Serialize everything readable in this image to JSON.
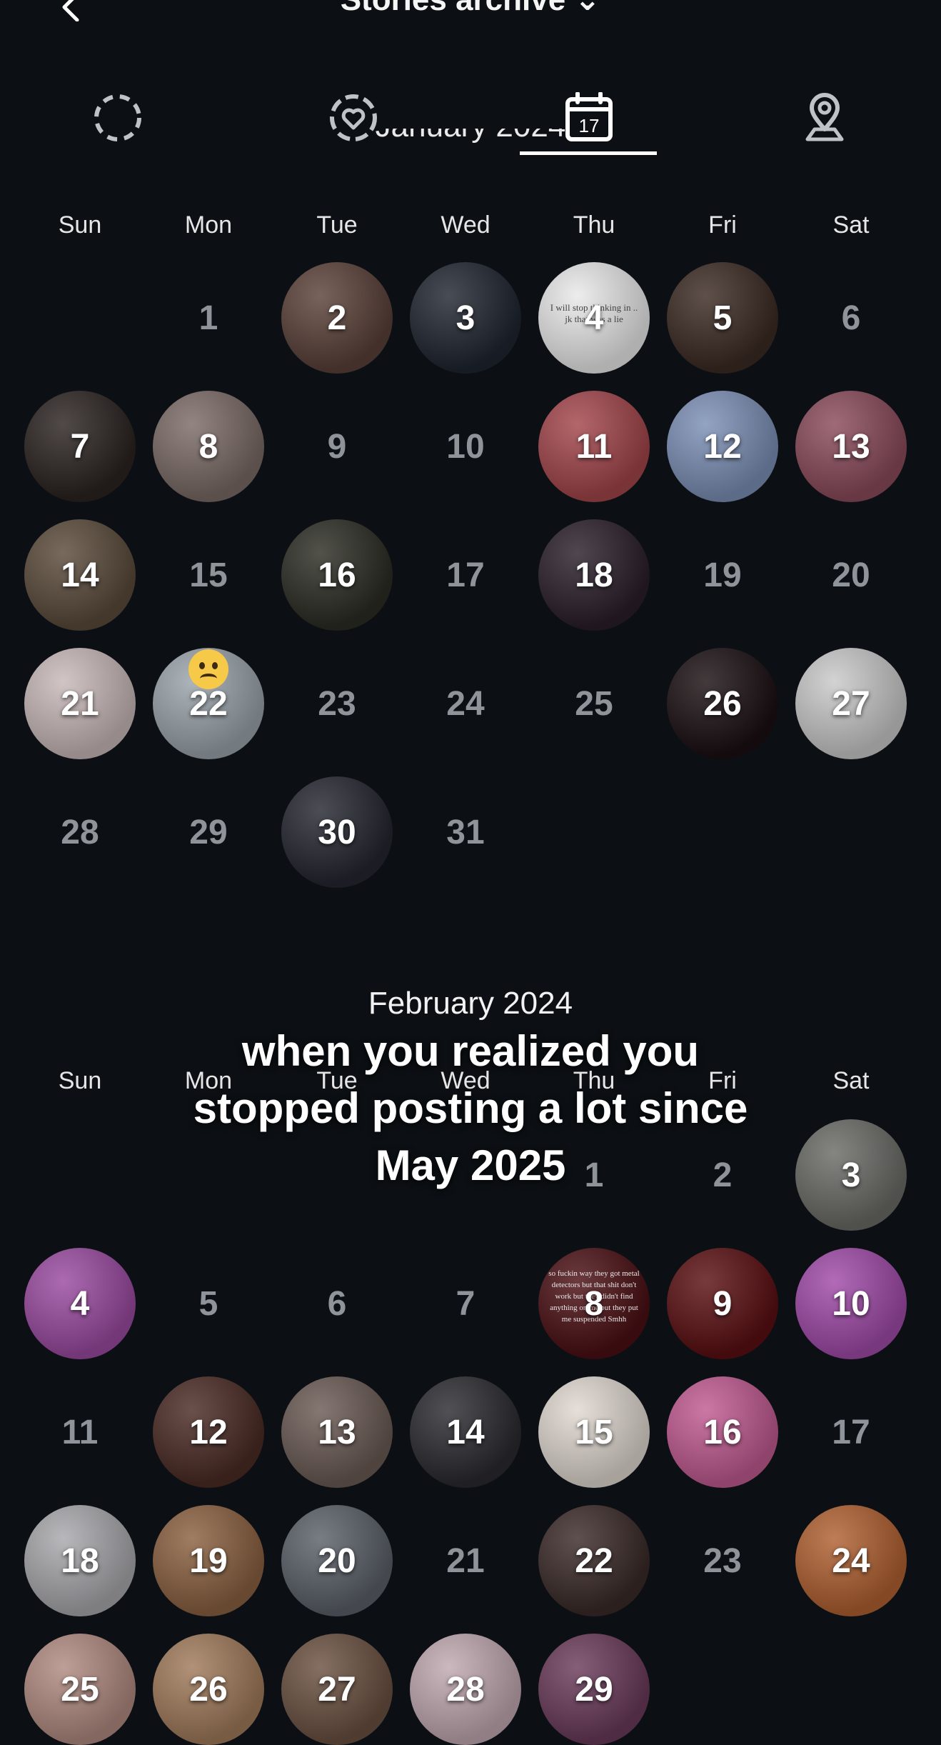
{
  "header": {
    "title": "Stories archive"
  },
  "tabs": [
    {
      "name": "tab-all",
      "icon": "dashed-circle-icon",
      "active": false
    },
    {
      "name": "tab-highlights",
      "icon": "heart-circle-icon",
      "active": false
    },
    {
      "name": "tab-calendar",
      "icon": "calendar-icon",
      "calendar_day": "17",
      "active": true
    },
    {
      "name": "tab-map",
      "icon": "map-pin-icon",
      "active": false
    }
  ],
  "weekdays": [
    "Sun",
    "Mon",
    "Tue",
    "Wed",
    "Thu",
    "Fri",
    "Sat"
  ],
  "months": [
    {
      "title": "January 2024",
      "first_weekday": 1,
      "days": 31,
      "story_days": {
        "2": "#5a4038",
        "3": "#1f2530",
        "4": "#e9e9ea",
        "5": "#3b2a22",
        "7": "#2a2220",
        "8": "#7a6a66",
        "11": "#a2454a",
        "12": "#7b8fb5",
        "13": "#8a4a5a",
        "14": "#5a4a3a",
        "16": "#2c2c24",
        "18": "#2a1e2a",
        "21": "#c8b8b8",
        "22": "#9aa3aa",
        "26": "#1a0f12",
        "27": "#c9c9c9",
        "30": "#242630"
      },
      "story_text": {
        "4": "I will stop thinking in .. jk that was a lie"
      }
    },
    {
      "title": "February 2024",
      "first_weekday": 4,
      "days": 29,
      "story_days": {
        "3": "#6a6a66",
        "4": "#9a4aa0",
        "8": "#4a0f14",
        "9": "#5a0f12",
        "10": "#a04aa8",
        "12": "#4a2a24",
        "13": "#6a5a54",
        "14": "#2a2a30",
        "15": "#e0d8d0",
        "16": "#c05a90",
        "18": "#a8a8ac",
        "19": "#8a6040",
        "20": "#5a6068",
        "22": "#3a2a28",
        "24": "#b06030",
        "25": "#b08a80",
        "26": "#a07a5a",
        "27": "#6a5040",
        "28": "#c0a8b0",
        "29": "#6a3a5a"
      },
      "story_text": {
        "8": "so fuckin way they got metal detectors but that shit don't work but they didn't find anything on me but they put me suspended Smhh"
      }
    }
  ],
  "overlay_caption": {
    "line1": "when you realized you",
    "line2": "stopped posting a lot since",
    "line3": "May 2025"
  },
  "colors": {
    "background": "#0c1014",
    "active_tab_underline": "#ffffff",
    "empty_day_number": "#8f949a"
  }
}
